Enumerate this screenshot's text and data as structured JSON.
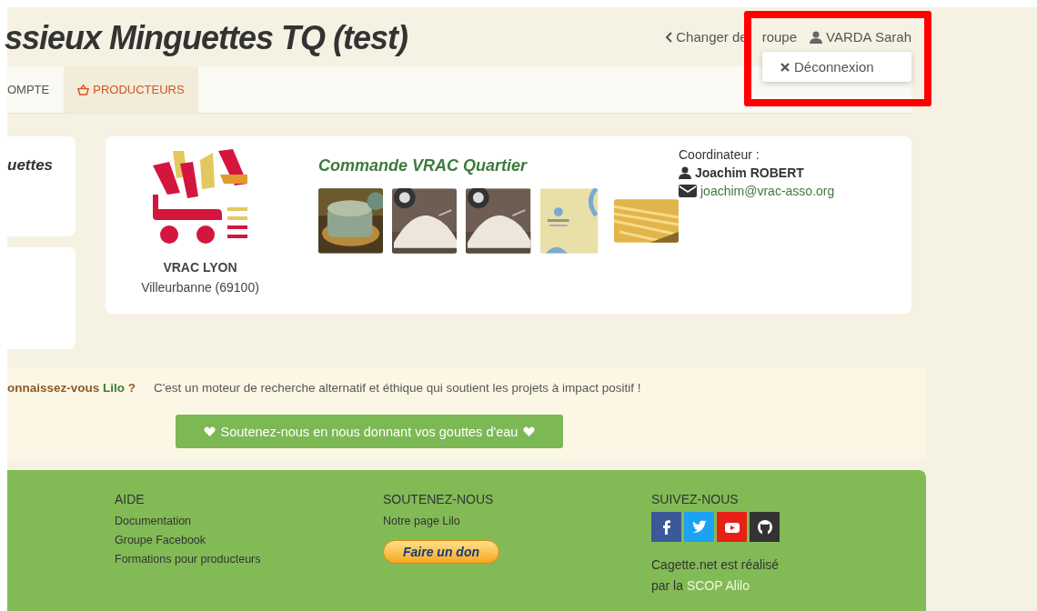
{
  "header": {
    "title": "ssieux Minguettes TQ (test)",
    "change_group": [
      "Changer de",
      "roupe"
    ],
    "user_menu": {
      "name": "VARDA Sarah",
      "expanded": true,
      "items": [
        "Déconnexion"
      ]
    }
  },
  "tabs": [
    {
      "label": "OMPTE",
      "selected": false,
      "has_icon": false
    },
    {
      "label": "PRODUCTEURS",
      "selected": true,
      "has_icon": true
    }
  ],
  "sidebar": {
    "group_name": "uettes"
  },
  "producer": {
    "name": "VRAC LYON",
    "city": "Villeurbanne (69100)",
    "catalog_title": "Commande VRAC Quartier",
    "products": [
      {
        "kind": "cheese"
      },
      {
        "kind": "flour"
      },
      {
        "kind": "flour"
      },
      {
        "kind": "box"
      },
      {
        "kind": "pasta"
      }
    ],
    "coordinator_label": "Coordinateur :",
    "coordinator_name": "Joachim ROBERT",
    "coordinator_email": "joachim@vrac-asso.org"
  },
  "lilo": {
    "question_start": "onnaissez-vous ",
    "question_link": "Lilo",
    "question_end": " ?",
    "description": "C'est un moteur de recherche alternatif et éthique qui soutient les projets à impact positif !",
    "button": "Soutenez-nous en nous donnant vos gouttes d'eau"
  },
  "footer": {
    "columns": [
      {
        "title": "AIDE",
        "links": [
          "Documentation",
          "Groupe Facebook",
          "Formations pour producteurs"
        ]
      },
      {
        "title": "SOUTENEZ-NOUS",
        "links": [
          "Notre page Lilo"
        ],
        "donate": "Faire un don"
      },
      {
        "title": "SUIVEZ-NOUS",
        "social": [
          {
            "kind": "facebook"
          },
          {
            "kind": "twitter"
          },
          {
            "kind": "youtube"
          },
          {
            "kind": "github"
          }
        ],
        "credit_start": "Cagette.net est réalisé",
        "credit_prefix": "par la ",
        "credit_link": "SCOP Alilo"
      }
    ]
  }
}
